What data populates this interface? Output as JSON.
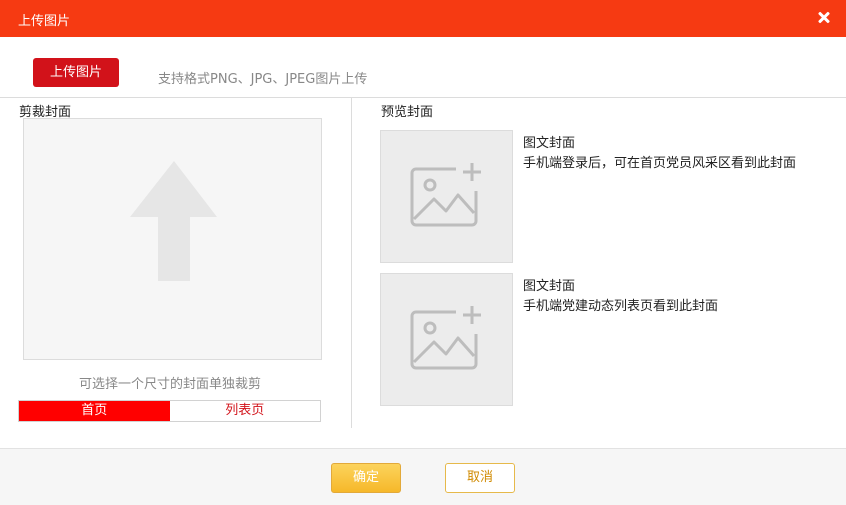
{
  "dialog": {
    "title": "上传图片",
    "close_icon": "close-icon"
  },
  "upload": {
    "button_label": "上传图片",
    "hint": "支持格式PNG、JPG、JPEG图片上传"
  },
  "crop": {
    "title": "剪裁封面",
    "placeholder_icon": "upload-arrow-icon",
    "hint": "可选择一个尺寸的封面单独裁剪",
    "tabs": [
      {
        "label": "首页",
        "active": true
      },
      {
        "label": "列表页",
        "active": false
      }
    ]
  },
  "preview": {
    "title": "预览封面",
    "items": [
      {
        "title": "图文封面",
        "desc": "手机端登录后，可在首页党员风采区看到此封面",
        "icon": "add-image-icon"
      },
      {
        "title": "图文封面",
        "desc": "手机端党建动态列表页看到此封面",
        "icon": "add-image-icon"
      }
    ]
  },
  "footer": {
    "confirm_label": "确定",
    "cancel_label": "取消"
  },
  "colors": {
    "header_bg": "#f63a12",
    "primary_red": "#d2121a",
    "active_tab": "#ff0000",
    "confirm_gold": "#f6b82a"
  }
}
